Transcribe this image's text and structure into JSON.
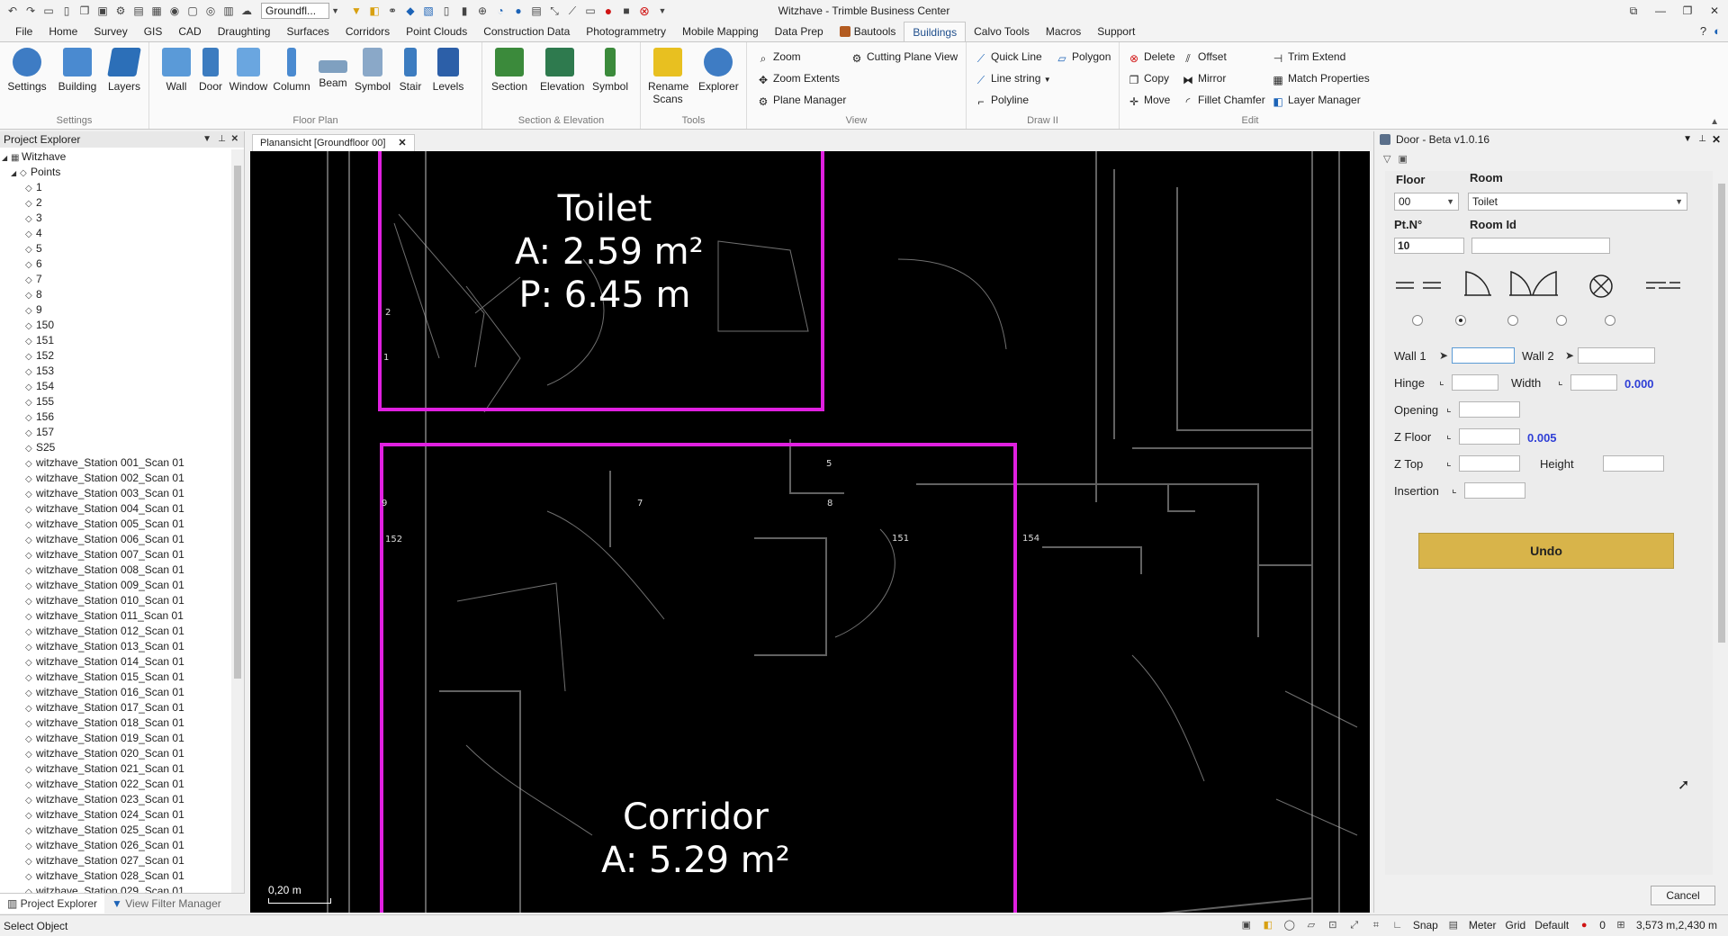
{
  "window": {
    "title": "Witzhave - Trimble Business Center",
    "combo_value": "Groundfl..."
  },
  "menu_tabs": [
    "File",
    "Home",
    "Survey",
    "GIS",
    "CAD",
    "Draughting",
    "Surfaces",
    "Corridors",
    "Point Clouds",
    "Construction Data",
    "Photogrammetry",
    "Mobile Mapping",
    "Data Prep",
    "Bautools",
    "Buildings",
    "Calvo Tools",
    "Macros",
    "Support"
  ],
  "active_tab": "Buildings",
  "ribbon": {
    "settings": {
      "title": "Settings",
      "buttons": [
        "Settings",
        "Building",
        "Layers"
      ]
    },
    "floor_plan": {
      "title": "Floor Plan",
      "buttons": [
        "Wall",
        "Door",
        "Window",
        "Column",
        "Beam",
        "Symbol",
        "Stair",
        "Levels"
      ]
    },
    "section": {
      "title": "Section & Elevation",
      "buttons": [
        "Section",
        "Elevation",
        "Symbol"
      ]
    },
    "tools": {
      "title": "Tools",
      "rename": "Rename",
      "scans": "Scans",
      "explorer": "Explorer"
    },
    "view": {
      "title": "View",
      "items": [
        "Zoom",
        "Zoom Extents",
        "Plane Manager",
        "Cutting Plane View"
      ]
    },
    "draw": {
      "title": "Draw II",
      "items": [
        "Quick Line",
        "Polygon",
        "Line string",
        "Polyline"
      ]
    },
    "edit": {
      "title": "Edit",
      "items": [
        "Delete",
        "Copy",
        "Move",
        "Offset",
        "Mirror",
        "Fillet Chamfer",
        "Trim Extend",
        "Match Properties",
        "Layer Manager"
      ]
    }
  },
  "explorer": {
    "title": "Project Explorer",
    "root": "Witzhave",
    "points_label": "Points",
    "items": [
      "1",
      "2",
      "3",
      "4",
      "5",
      "6",
      "7",
      "8",
      "9",
      "150",
      "151",
      "152",
      "153",
      "154",
      "155",
      "156",
      "157",
      "S25",
      "witzhave_Station 001_Scan 01",
      "witzhave_Station 002_Scan 01",
      "witzhave_Station 003_Scan 01",
      "witzhave_Station 004_Scan 01",
      "witzhave_Station 005_Scan 01",
      "witzhave_Station 006_Scan 01",
      "witzhave_Station 007_Scan 01",
      "witzhave_Station 008_Scan 01",
      "witzhave_Station 009_Scan 01",
      "witzhave_Station 010_Scan 01",
      "witzhave_Station 011_Scan 01",
      "witzhave_Station 012_Scan 01",
      "witzhave_Station 013_Scan 01",
      "witzhave_Station 014_Scan 01",
      "witzhave_Station 015_Scan 01",
      "witzhave_Station 016_Scan 01",
      "witzhave_Station 017_Scan 01",
      "witzhave_Station 018_Scan 01",
      "witzhave_Station 019_Scan 01",
      "witzhave_Station 020_Scan 01",
      "witzhave_Station 021_Scan 01",
      "witzhave_Station 022_Scan 01",
      "witzhave_Station 023_Scan 01",
      "witzhave_Station 024_Scan 01",
      "witzhave_Station 025_Scan 01",
      "witzhave_Station 026_Scan 01",
      "witzhave_Station 027_Scan 01",
      "witzhave_Station 028_Scan 01",
      "witzhave_Station 029_Scan 01"
    ],
    "bottom_tabs": [
      "Project Explorer",
      "View Filter Manager"
    ]
  },
  "document_tab": "Planansicht  [Groundfloor 00]",
  "viewport": {
    "toilet": {
      "name": "Toilet",
      "area": "A: 2.59 m²",
      "perimeter": "P: 6.45 m"
    },
    "corridor": {
      "name": "Corridor",
      "area": "A: 5.29 m²"
    },
    "point_labels": [
      "2",
      "1",
      "5",
      "9",
      "7",
      "8",
      "152",
      "151",
      "154"
    ],
    "scale": "0,20 m",
    "outline_color": "#e020e0"
  },
  "door_panel": {
    "title": "Door - Beta v1.0.16",
    "floor_label": "Floor",
    "room_label": "Room",
    "floor_value": "00",
    "room_value": "Toilet",
    "ptno_label": "Pt.N°",
    "roomid_label": "Room Id",
    "ptno_value": "10",
    "wall1": "Wall 1",
    "wall2": "Wall 2",
    "hinge": "Hinge",
    "width": "Width",
    "width_value": "0.000",
    "opening": "Opening",
    "zfloor": "Z Floor",
    "zfloor_value": "0.005",
    "ztop": "Z Top",
    "height": "Height",
    "insertion": "Insertion",
    "undo": "Undo",
    "cancel": "Cancel",
    "selected_door_type": 2
  },
  "status": {
    "text": "Select Object",
    "snap": "Snap",
    "unit": "Meter",
    "grid": "Grid",
    "layer": "Default",
    "count": "0",
    "coords": "3,573 m,2,430 m"
  }
}
